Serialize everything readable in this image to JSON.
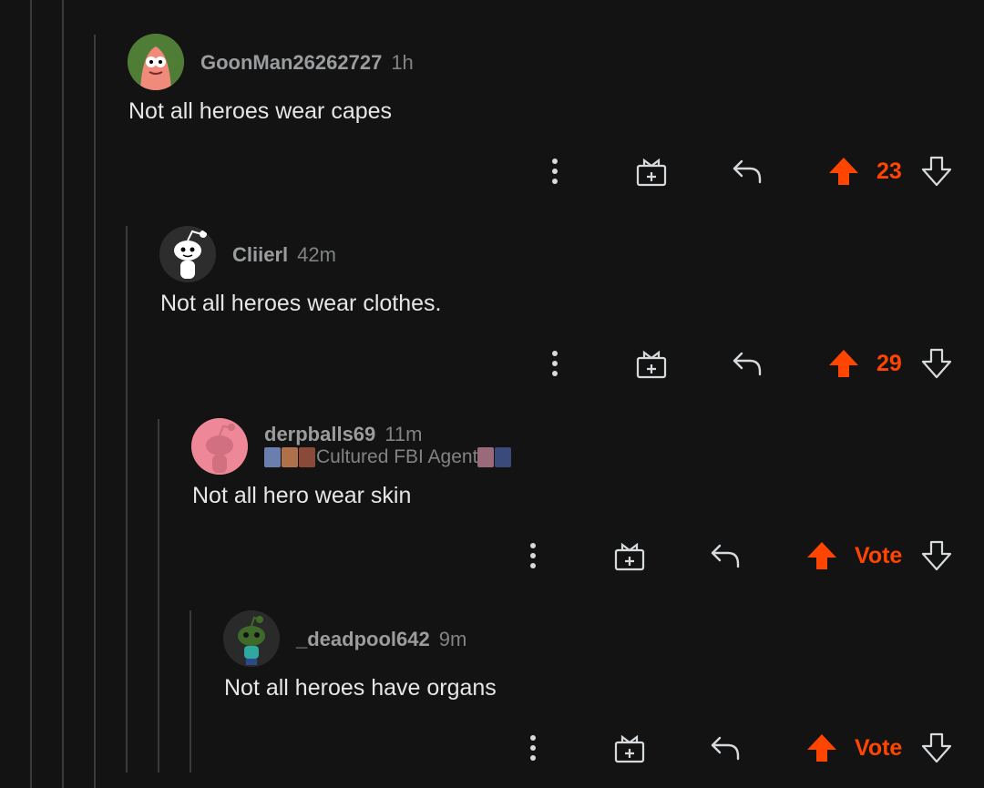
{
  "colors": {
    "background": "#131313",
    "upvote_active": "#ff4500",
    "thread_line": "#3a3a3c",
    "text": "#e6e6e6",
    "meta": "#818384"
  },
  "comments": [
    {
      "username": "GoonMan26262727",
      "time": "1h",
      "body": "Not all heroes wear capes",
      "score": "23",
      "avatar_icon": "patrick-avatar-icon"
    },
    {
      "username": "Cliierl",
      "time": "42m",
      "body": "Not all heroes wear clothes.",
      "score": "29",
      "avatar_icon": "snoo-avatar-icon"
    },
    {
      "username": "derpballs69",
      "time": "11m",
      "flair": "Cultured FBI Agent",
      "body": "Not all hero wear skin",
      "score": "Vote",
      "avatar_icon": "pink-snoo-avatar-icon"
    },
    {
      "username": "_deadpool642",
      "time": "9m",
      "body": "Not all heroes have organs",
      "score": "Vote",
      "avatar_icon": "green-snoo-avatar-icon"
    }
  ]
}
